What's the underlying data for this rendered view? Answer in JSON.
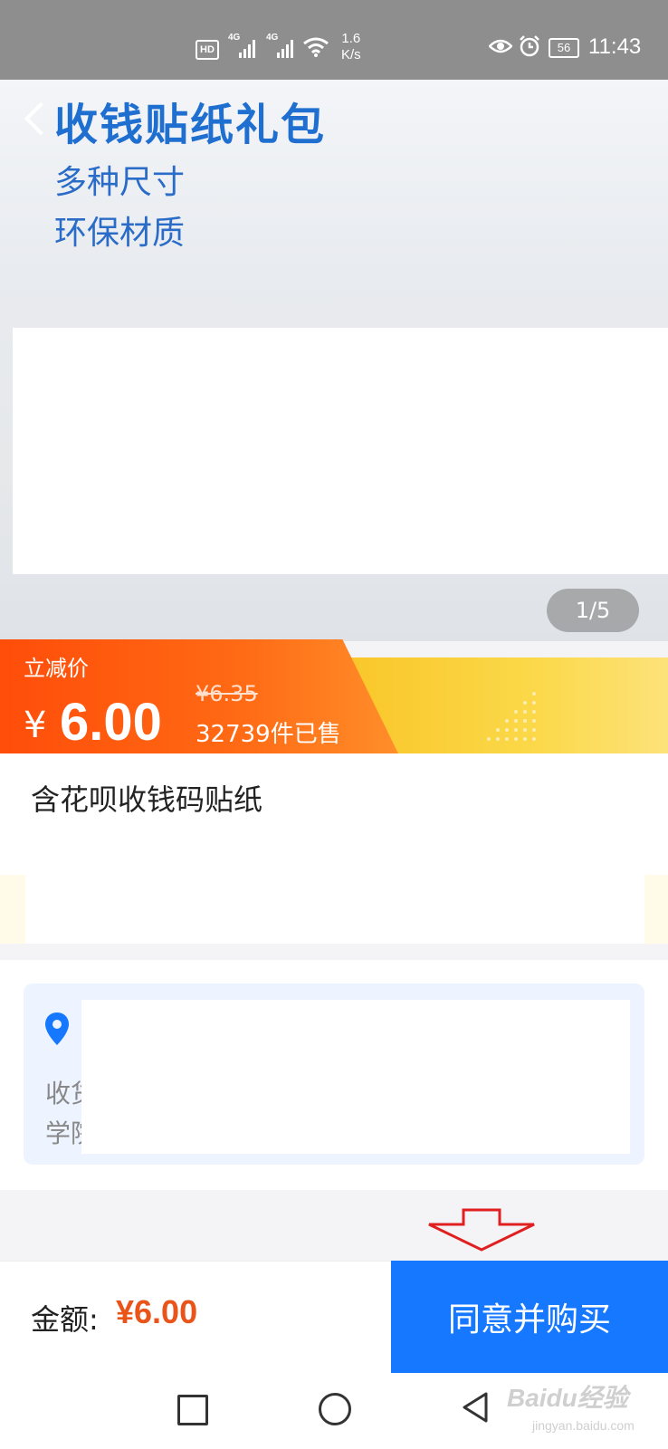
{
  "status_bar": {
    "hd": "HD",
    "net1": "4G",
    "net2": "4G",
    "speed_value": "1.6",
    "speed_unit": "K/s",
    "battery": "56",
    "time": "11:43"
  },
  "banner": {
    "title": "收钱贴纸礼包",
    "line1": "多种尺寸",
    "line2": "环保材质",
    "image_counter": "1/5"
  },
  "price": {
    "label": "立减价",
    "currency": "¥",
    "current": "6.00",
    "original": "¥6.35",
    "sold": "32739件已售"
  },
  "product": {
    "title": "含花呗收钱码贴纸"
  },
  "address": {
    "label_line1": "收货",
    "label_line2": "学院"
  },
  "bottom": {
    "amount_label": "金额:",
    "amount_value": "¥6.00",
    "buy_button": "同意并购买"
  },
  "watermark": {
    "text": "Baidu经验",
    "sub": "jingyan.baidu.com"
  },
  "colors": {
    "accent_blue": "#1678ff",
    "price_orange": "#ff5a0f",
    "amount_orange": "#e8541a",
    "title_blue": "#1f6fd0"
  }
}
